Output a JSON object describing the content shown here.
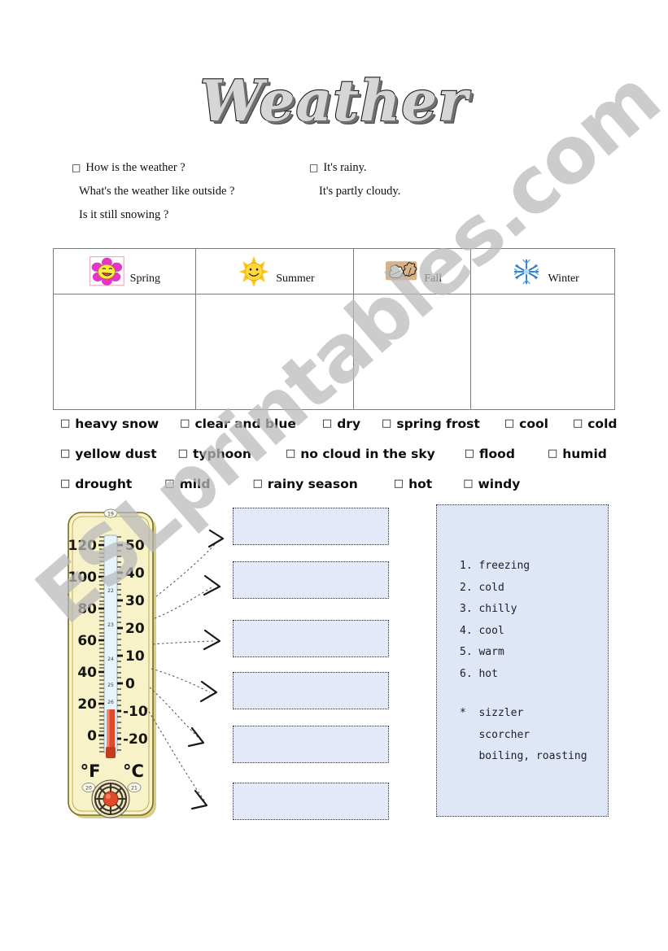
{
  "title": "Weather",
  "watermark": "ESLprintables.com",
  "qa": {
    "questions": [
      {
        "bullet": "□",
        "text": "How is the weather ?"
      },
      {
        "bullet": "",
        "text": "What's the weather like outside ?"
      },
      {
        "bullet": "",
        "text": "Is it still snowing ?"
      }
    ],
    "answers": [
      {
        "bullet": "□",
        "text": "It's rainy."
      },
      {
        "bullet": "",
        "text": "It's partly cloudy."
      },
      {
        "bullet": "",
        "text": ""
      }
    ]
  },
  "seasons": [
    {
      "label": "Spring",
      "icon": "flower-icon"
    },
    {
      "label": "Summer",
      "icon": "sun-icon"
    },
    {
      "label": "Fall",
      "icon": "leaves-icon"
    },
    {
      "label": "Winter",
      "icon": "snowflake-icon"
    }
  ],
  "vocabulary": {
    "checkbox": "□",
    "rows": [
      [
        {
          "label": "heavy snow",
          "gap": 0
        },
        {
          "label": "clear and blue",
          "gap": 26
        },
        {
          "label": "dry",
          "gap": 32
        },
        {
          "label": "spring frost",
          "gap": 26
        },
        {
          "label": "cool",
          "gap": 30
        },
        {
          "label": "cold",
          "gap": 30
        }
      ],
      [
        {
          "label": "yellow dust",
          "gap": 0
        },
        {
          "label": "typhoon",
          "gap": 26
        },
        {
          "label": "no cloud in the sky",
          "gap": 42
        },
        {
          "label": "flood",
          "gap": 36
        },
        {
          "label": "humid",
          "gap": 40
        }
      ],
      [
        {
          "label": "drought",
          "gap": 0
        },
        {
          "label": "mild",
          "gap": 40
        },
        {
          "label": "rainy season",
          "gap": 52
        },
        {
          "label": "hot",
          "gap": 44
        },
        {
          "label": "windy",
          "gap": 38
        }
      ]
    ]
  },
  "thermometer": {
    "fahrenheit_label": "°F",
    "celsius_label": "°C",
    "fahrenheit_ticks": [
      "120",
      "100",
      "80",
      "60",
      "40",
      "20",
      "0"
    ],
    "celsius_ticks": [
      "50",
      "40",
      "30",
      "20",
      "10",
      "0",
      "-10",
      "-20"
    ],
    "small_labels": [
      "19",
      "22",
      "23",
      "24",
      "25",
      "26",
      "20",
      "21"
    ],
    "mercury_color": "#e04a2a",
    "body_color": "#f7f2c8"
  },
  "answer_boxes": [
    {
      "id": 1,
      "value": ""
    },
    {
      "id": 2,
      "value": ""
    },
    {
      "id": 3,
      "value": ""
    },
    {
      "id": 4,
      "value": ""
    },
    {
      "id": 5,
      "value": ""
    },
    {
      "id": 6,
      "value": ""
    }
  ],
  "wordbank": {
    "numbered": [
      "1. freezing",
      "2. cold",
      "3. chilly",
      "4. cool",
      "5. warm",
      "6. hot"
    ],
    "extras": [
      "*  sizzler",
      "   scorcher",
      "   boiling, roasting"
    ]
  },
  "colors": {
    "answer_box_fill": "#e3e9f8",
    "wordbank_fill": "#dfe6f6",
    "watermark": "#b9b9b9",
    "table_border": "#7c7c7c"
  }
}
